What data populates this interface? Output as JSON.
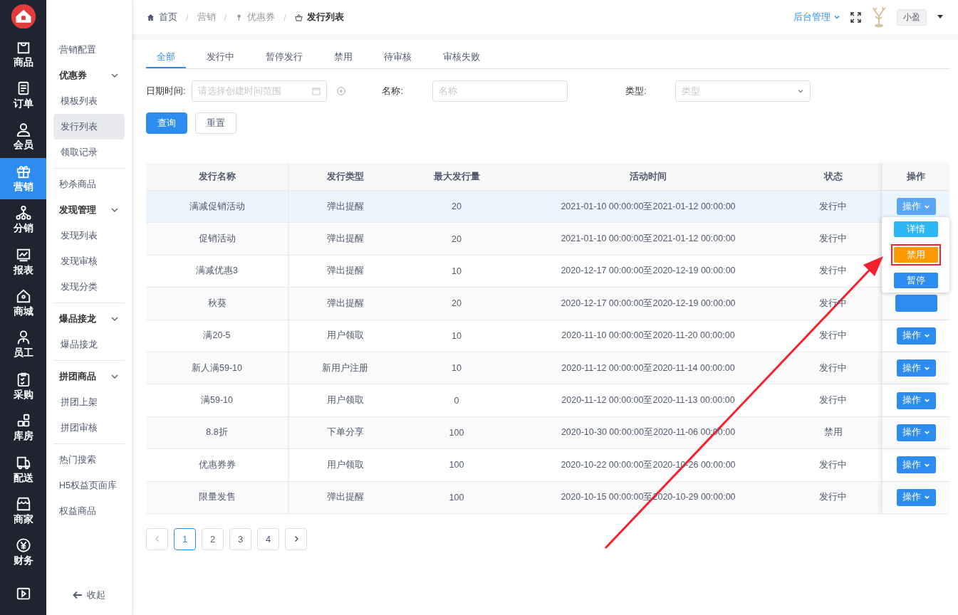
{
  "rail": {
    "items": [
      {
        "label": "商品",
        "selected": false
      },
      {
        "label": "订单",
        "selected": false
      },
      {
        "label": "会员",
        "selected": false
      },
      {
        "label": "营销",
        "selected": true
      },
      {
        "label": "分销",
        "selected": false
      },
      {
        "label": "报表",
        "selected": false
      },
      {
        "label": "商城",
        "selected": false
      },
      {
        "label": "员工",
        "selected": false
      },
      {
        "label": "采购",
        "selected": false
      },
      {
        "label": "库房",
        "selected": false
      },
      {
        "label": "配送",
        "selected": false
      },
      {
        "label": "商家",
        "selected": false
      },
      {
        "label": "财务",
        "selected": false
      }
    ]
  },
  "sidebar": {
    "sections": [
      {
        "items": [
          {
            "kind": "link",
            "label": "营销配置",
            "selected": false
          },
          {
            "kind": "group",
            "label": "优惠券",
            "expanded": true,
            "children": [
              {
                "label": "模板列表",
                "selected": false
              },
              {
                "label": "发行列表",
                "selected": true
              },
              {
                "label": "领取记录",
                "selected": false
              }
            ]
          }
        ]
      },
      {
        "items": [
          {
            "kind": "link",
            "label": "秒杀商品",
            "selected": false
          },
          {
            "kind": "group",
            "label": "发现管理",
            "expanded": true,
            "children": [
              {
                "label": "发现列表",
                "selected": false
              },
              {
                "label": "发现审核",
                "selected": false
              },
              {
                "label": "发现分类",
                "selected": false
              }
            ]
          }
        ]
      },
      {
        "items": [
          {
            "kind": "group",
            "label": "爆品接龙",
            "expanded": true,
            "children": [
              {
                "label": "爆品接龙",
                "selected": false
              }
            ]
          }
        ]
      },
      {
        "items": [
          {
            "kind": "group",
            "label": "拼团商品",
            "expanded": true,
            "children": [
              {
                "label": "拼团上架",
                "selected": false
              },
              {
                "label": "拼团审核",
                "selected": false
              }
            ]
          }
        ]
      },
      {
        "items": [
          {
            "kind": "link",
            "label": "热门搜索",
            "selected": false
          },
          {
            "kind": "link",
            "label": "H5权益页面库",
            "selected": false
          },
          {
            "kind": "link",
            "label": "权益商品",
            "selected": false
          }
        ]
      }
    ],
    "collapse": "收起"
  },
  "header": {
    "breadcrumb": [
      "首页",
      "营销",
      "优惠券",
      "发行列表"
    ],
    "separator": "/",
    "menu": "后台管理",
    "user": "小盈"
  },
  "tabs": [
    {
      "label": "全部",
      "selected": true
    },
    {
      "label": "发行中",
      "selected": false
    },
    {
      "label": "暂停发行",
      "selected": false
    },
    {
      "label": "禁用",
      "selected": false
    },
    {
      "label": "待审核",
      "selected": false
    },
    {
      "label": "审核失败",
      "selected": false
    }
  ],
  "filters": {
    "date_label": "日期时间:",
    "date_placeholder": "请选择创建时间范围",
    "name_label": "名称:",
    "name_placeholder": "名称",
    "type_label": "类型:",
    "type_placeholder": "类型"
  },
  "buttons": [
    "查询",
    "重置"
  ],
  "table": {
    "columns": [
      "发行名称",
      "发行类型",
      "最大发行量",
      "活动时间",
      "状态",
      "操作"
    ],
    "rows": [
      {
        "name": "满减促销活动",
        "type": "弹出提醒",
        "max": "20",
        "time": "2021-01-10 00:00:00至2021-01-12 00:00:00",
        "status": "发行中",
        "action": "操作",
        "hovered": true
      },
      {
        "name": "促销活动",
        "type": "弹出提醒",
        "max": "20",
        "time": "2021-01-10 00:00:00至2021-01-12 00:00:00",
        "status": "发行中",
        "hovered": false
      },
      {
        "name": "满减优惠3",
        "type": "弹出提醒",
        "max": "10",
        "time": "2020-12-17 00:00:00至2020-12-19 00:00:00",
        "status": "发行中",
        "hovered": false
      },
      {
        "name": "秋葵",
        "type": "弹出提醒",
        "max": "20",
        "time": "2020-12-17 00:00:00至2020-12-19 00:00:00",
        "status": "发行中",
        "action_covered": true,
        "hovered": false
      },
      {
        "name": "满20-5",
        "type": "用户领取",
        "max": "10",
        "time": "2020-11-10 00:00:00至2020-11-20 00:00:00",
        "status": "发行中",
        "action": "操作",
        "hovered": false
      },
      {
        "name": "新人满59-10",
        "type": "新用户注册",
        "max": "10",
        "time": "2020-11-12 00:00:00至2020-11-14 00:00:00",
        "status": "发行中",
        "action": "操作",
        "hovered": false
      },
      {
        "name": "满59-10",
        "type": "用户领取",
        "max": "0",
        "time": "2020-11-12 00:00:00至2020-11-13 00:00:00",
        "status": "发行中",
        "action": "操作",
        "hovered": false
      },
      {
        "name": "8.8折",
        "type": "下单分享",
        "max": "100",
        "time": "2020-10-30 00:00:00至2020-11-06 00:00:00",
        "status": "禁用",
        "action": "操作",
        "hovered": false
      },
      {
        "name": "优惠券券",
        "type": "用户领取",
        "max": "100",
        "time": "2020-10-22 00:00:00至2020-10-26 00:00:00",
        "status": "发行中",
        "action": "操作",
        "hovered": false
      },
      {
        "name": "限量发售",
        "type": "弹出提醒",
        "max": "100",
        "time": "2020-10-15 00:00:00至2020-10-29 00:00:00",
        "status": "发行中",
        "action": "操作",
        "hovered": false
      }
    ],
    "action_menu": [
      {
        "label": "详情",
        "color": "#2db7f5",
        "outlined": false
      },
      {
        "label": "禁用",
        "color": "#ff9900",
        "outlined": true
      },
      {
        "label": "暂停",
        "color": "#2d8cf0",
        "outlined": false
      }
    ]
  },
  "pagination": {
    "prev_disabled": true,
    "pages": [
      {
        "label": "1",
        "selected": true
      },
      {
        "label": "2",
        "selected": false
      },
      {
        "label": "3",
        "selected": false
      },
      {
        "label": "4",
        "selected": false
      }
    ]
  }
}
